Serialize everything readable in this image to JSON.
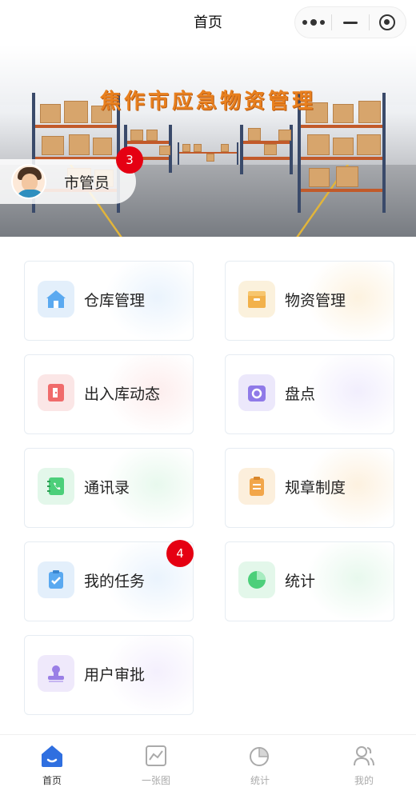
{
  "navbar": {
    "title": "首页"
  },
  "banner": {
    "title": "焦作市应急物资管理",
    "user_role": "市管员",
    "notification_count": "3"
  },
  "grid": [
    {
      "label": "仓库管理",
      "icon": "warehouse-icon",
      "color": "#5aa9f0",
      "glow": "#e3effb"
    },
    {
      "label": "物资管理",
      "icon": "supplies-box-icon",
      "color": "#f2b14a",
      "glow": "#fbf1dc"
    },
    {
      "label": "出入库动态",
      "icon": "in-out-door-icon",
      "color": "#f06b6b",
      "glow": "#fbe6e6"
    },
    {
      "label": "盘点",
      "icon": "inventory-check-icon",
      "color": "#8f7ae8",
      "glow": "#ece8fb"
    },
    {
      "label": "通讯录",
      "icon": "contacts-book-icon",
      "color": "#4ccf7a",
      "glow": "#e3f7ea"
    },
    {
      "label": "规章制度",
      "icon": "clipboard-rules-icon",
      "color": "#f2a64a",
      "glow": "#fcefdc"
    },
    {
      "label": "我的任务",
      "icon": "task-check-icon",
      "color": "#5aa9f0",
      "glow": "#e3effb",
      "badge": "4"
    },
    {
      "label": "统计",
      "icon": "pie-chart-icon",
      "color": "#4ccf7a",
      "glow": "#e3f7ea"
    },
    {
      "label": "用户审批",
      "icon": "approval-stamp-icon",
      "color": "#9a7fe6",
      "glow": "#efe9fb"
    }
  ],
  "tabbar": [
    {
      "label": "首页",
      "icon": "home-icon",
      "active": true
    },
    {
      "label": "一张图",
      "icon": "map-chart-icon",
      "active": false
    },
    {
      "label": "统计",
      "icon": "stats-pie-icon",
      "active": false
    },
    {
      "label": "我的",
      "icon": "profile-users-icon",
      "active": false
    }
  ],
  "colors": {
    "accent": "#2f6fe0",
    "badge": "#e50012",
    "inactive_tab": "#aaaaaa"
  }
}
